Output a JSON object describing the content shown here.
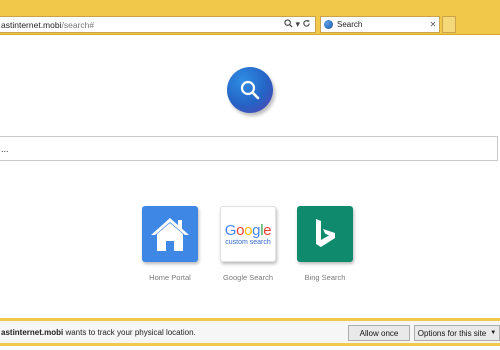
{
  "browser": {
    "address": {
      "host": "astinternet.mobi",
      "path": "/search#",
      "search_icon": "search-icon",
      "dropdown_icon": "chevron-down-icon",
      "refresh_icon": "refresh-icon"
    },
    "tab": {
      "title": "Search",
      "close": "✕",
      "favicon": "globe-icon"
    }
  },
  "main": {
    "search": {
      "value": "..."
    },
    "tiles": [
      {
        "label": "Home Portal",
        "icon": "home-icon",
        "color": "#3f87e4"
      },
      {
        "label": "Google Search",
        "logo_word": "Google",
        "logo_sub": "custom search",
        "color": "#ffffff"
      },
      {
        "label": "Bing Search",
        "icon": "bing-icon",
        "color": "#0f8a6d"
      }
    ]
  },
  "notification": {
    "site": "astinternet.mobi",
    "message": " wants to track your physical location.",
    "allow_label": "Allow once",
    "options_label": "Options for this site",
    "accent": "#f1c84a"
  }
}
